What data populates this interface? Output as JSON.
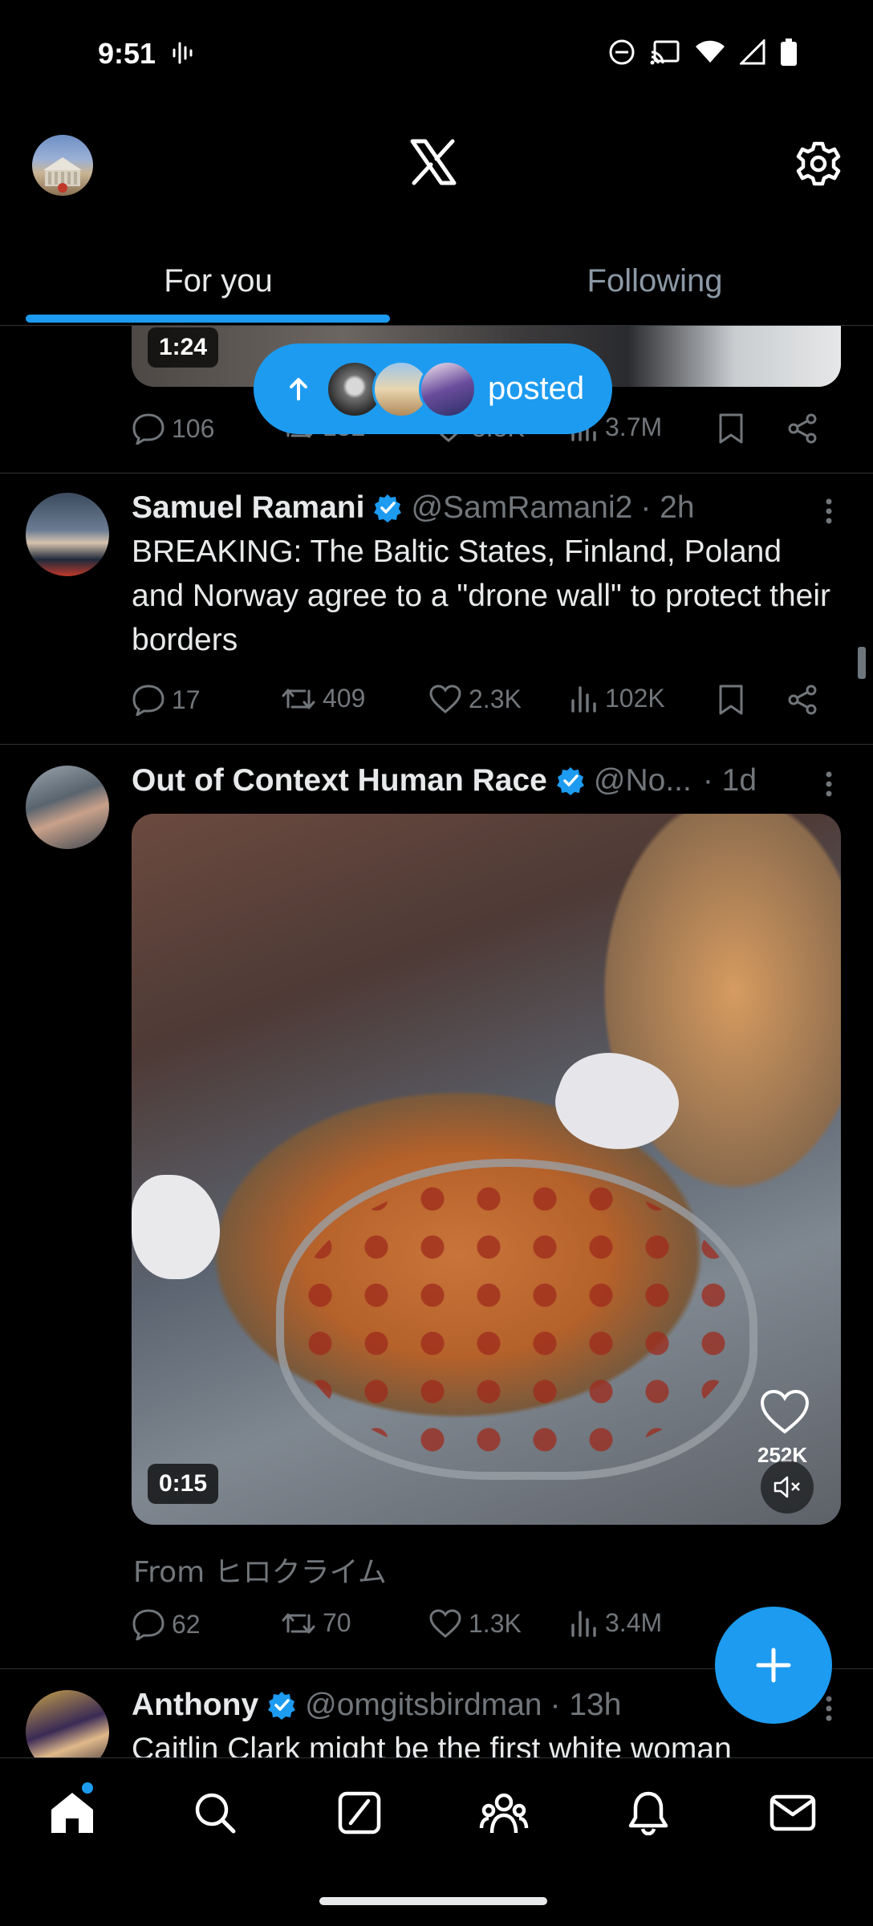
{
  "status_bar": {
    "time": "9:51",
    "left_icon": "audio-waveform-icon",
    "right_icons": [
      "do-not-disturb-icon",
      "cast-icon",
      "wifi-icon",
      "cellular-signal-icon",
      "battery-icon"
    ]
  },
  "header": {
    "profile_avatar": "profile-avatar",
    "logo": "x-logo-icon",
    "settings_icon": "gear-icon"
  },
  "tabs": [
    {
      "label": "For you",
      "active": true
    },
    {
      "label": "Following",
      "active": false
    }
  ],
  "new_posts_pill": {
    "label": "posted",
    "icon": "arrow-up-icon"
  },
  "posts": [
    {
      "media_duration": "1:24",
      "replies": "106",
      "reposts": "152",
      "likes": "3.5K",
      "views": "3.7M"
    },
    {
      "name": "Samuel Ramani",
      "verified": true,
      "handle": "@SamRamani2",
      "time": "· 2h",
      "text": "BREAKING: The Baltic States, Finland, Poland and Norway agree to a \"drone wall\" to protect their borders",
      "replies": "17",
      "reposts": "409",
      "likes": "2.3K",
      "views": "102K"
    },
    {
      "name": "Out of Context Human Race",
      "verified": true,
      "handle": "@No...",
      "time": "· 1d",
      "media_duration": "0:15",
      "video_like_count": "252K",
      "from_label": "From ヒロクライム",
      "replies": "62",
      "reposts": "70",
      "likes": "1.3K",
      "views": "3.4M"
    },
    {
      "name": "Anthony",
      "verified": true,
      "handle": "@omgitsbirdman",
      "time": "· 13h",
      "text": "Caitlin Clark might be the first white woman"
    }
  ],
  "fab": {
    "icon": "plus-icon"
  },
  "bottom_nav": [
    "home-icon",
    "search-icon",
    "grok-icon",
    "communities-icon",
    "notifications-icon",
    "messages-icon"
  ],
  "colors": {
    "accent": "#1d9bf0",
    "background": "#000000",
    "muted": "#71767b",
    "text": "#e7e9ea"
  }
}
